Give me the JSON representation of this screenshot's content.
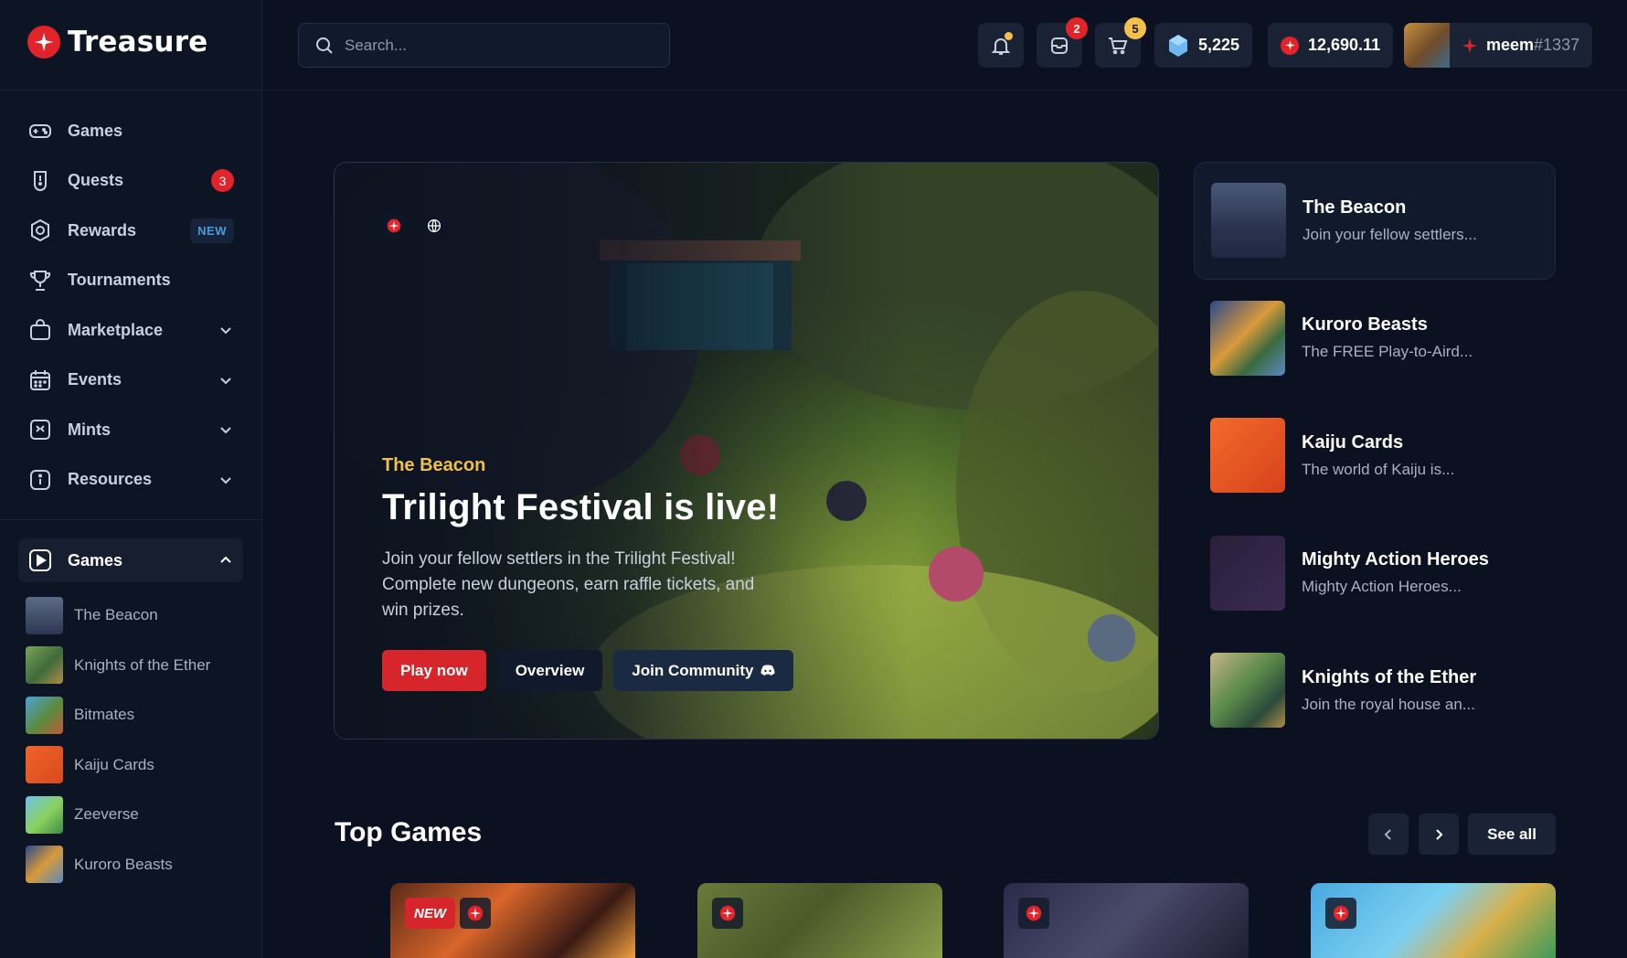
{
  "brand": {
    "name": "Treasure"
  },
  "sidebar": {
    "nav": [
      {
        "label": "Games",
        "icon": "gamepad-icon"
      },
      {
        "label": "Quests",
        "icon": "quest-icon",
        "badge": "3"
      },
      {
        "label": "Rewards",
        "icon": "rewards-icon",
        "tag": "NEW"
      },
      {
        "label": "Tournaments",
        "icon": "trophy-icon"
      },
      {
        "label": "Marketplace",
        "icon": "shopping-bag-icon"
      },
      {
        "label": "Events",
        "icon": "calendar-icon"
      },
      {
        "label": "Mints",
        "icon": "mint-icon"
      },
      {
        "label": "Resources",
        "icon": "info-icon"
      }
    ],
    "games_section": {
      "label": "Games"
    },
    "games": [
      {
        "name": "The Beacon"
      },
      {
        "name": "Knights of the Ether"
      },
      {
        "name": "Bitmates"
      },
      {
        "name": "Kaiju Cards"
      },
      {
        "name": "Zeeverse"
      },
      {
        "name": "Kuroro Beasts"
      }
    ]
  },
  "topbar": {
    "search": {
      "placeholder": "Search..."
    },
    "inbox_count": "2",
    "cart_count": "5",
    "gems": "5,225",
    "magic": "12,690.11",
    "user": {
      "name": "meem",
      "tag": "#1337"
    }
  },
  "hero": {
    "subtitle": "The Beacon",
    "title": "Trilight Festival is live!",
    "description": "Join your fellow settlers in the Trilight Festival! Complete new dungeons, earn raffle tickets, and win prizes.",
    "buttons": {
      "play": "Play now",
      "overview": "Overview",
      "community": "Join Community"
    }
  },
  "featured": [
    {
      "title": "The Beacon",
      "desc": "Join your fellow settlers..."
    },
    {
      "title": "Kuroro Beasts",
      "desc": "The FREE Play-to-Aird..."
    },
    {
      "title": "Kaiju Cards",
      "desc": "The world of Kaiju is..."
    },
    {
      "title": "Mighty Action Heroes",
      "desc": "Mighty Action Heroes..."
    },
    {
      "title": "Knights of the Ether",
      "desc": "Join the royal house an..."
    }
  ],
  "top_games": {
    "title": "Top Games",
    "see_all": "See all",
    "new_label": "NEW"
  },
  "colors": {
    "accent": "#d7262b",
    "gold": "#f0c14b",
    "bg": "#0b1120"
  }
}
